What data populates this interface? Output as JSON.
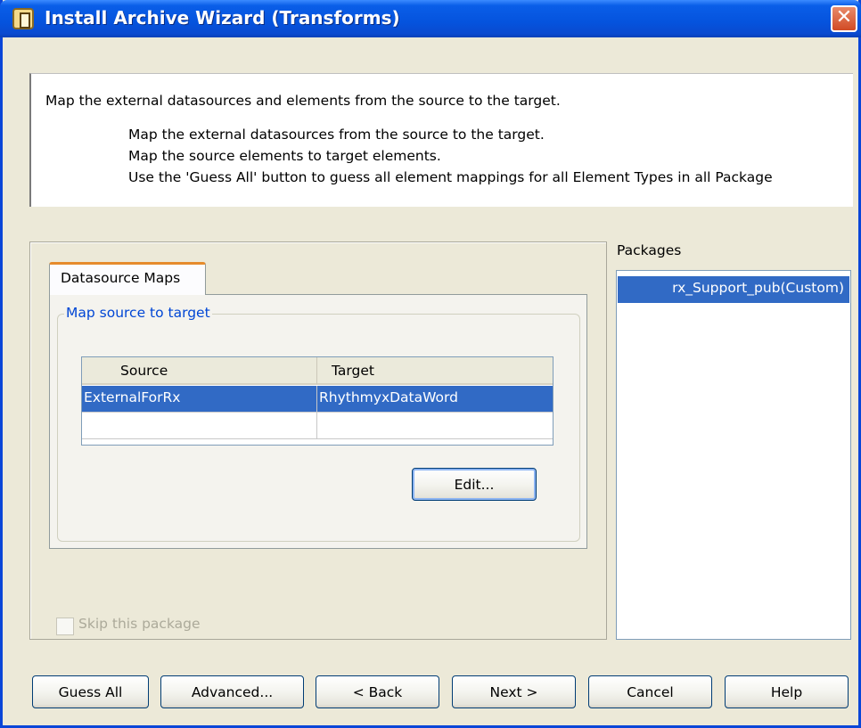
{
  "window": {
    "title": "Install Archive Wizard (Transforms)",
    "close_glyph": "✕"
  },
  "header": {
    "main": "Map the external datasources and elements from the source to the target.",
    "lines": [
      "Map the external datasources from the source to the target.",
      "Map the source elements to target elements.",
      "Use the 'Guess All' button to guess all element mappings for all Element Types in all Package"
    ]
  },
  "tabs": [
    {
      "label": "Datasource Maps",
      "selected": true
    }
  ],
  "group": {
    "title": "Map source to target"
  },
  "mapping_table": {
    "columns": [
      "Source",
      "Target"
    ],
    "rows": [
      {
        "source": "ExternalForRx",
        "target": "RhythmyxDataWord",
        "selected": true
      },
      {
        "source": "",
        "target": "",
        "selected": false
      }
    ]
  },
  "edit_button": {
    "label": "Edit..."
  },
  "skip_checkbox": {
    "label": "Skip this package",
    "checked": false,
    "enabled": false
  },
  "packages": {
    "label": "Packages",
    "items": [
      {
        "label": "rx_Support_pub(Custom)",
        "selected": true
      }
    ]
  },
  "footer_buttons": {
    "guess_all": "Guess All",
    "advanced": "Advanced...",
    "back": "< Back",
    "next": "Next >",
    "cancel": "Cancel",
    "help": "Help"
  },
  "colors": {
    "titlebar": "#0553dd",
    "selection": "#316ac5",
    "tab_accent": "#e68b2c",
    "group_title": "#0046d5",
    "dialog_bg": "#ece9d8"
  }
}
